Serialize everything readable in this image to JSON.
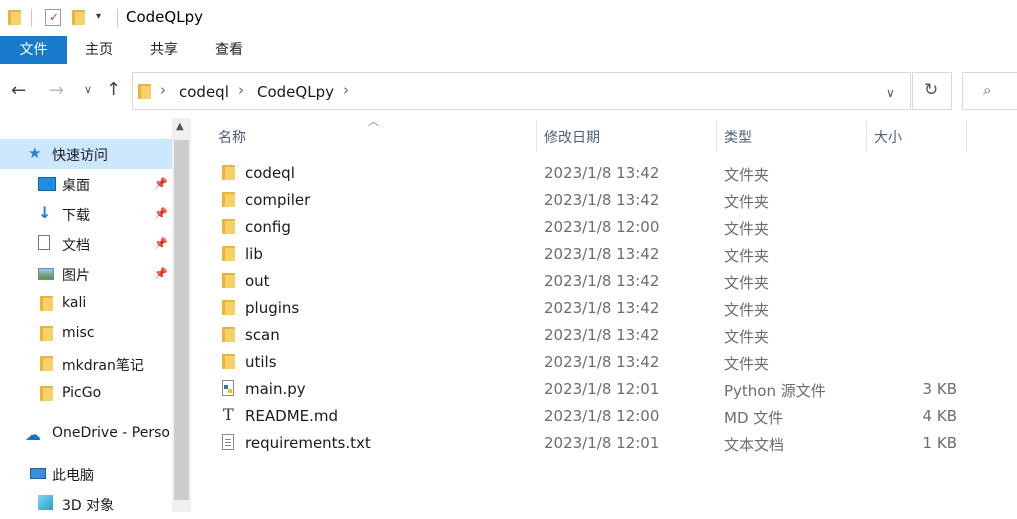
{
  "window": {
    "title": "CodeQLpy"
  },
  "ribbon": {
    "tabs": [
      "文件",
      "主页",
      "共享",
      "查看"
    ]
  },
  "address": {
    "crumbs": [
      "codeql",
      "CodeQLpy"
    ]
  },
  "nav": {
    "items": [
      {
        "label": "快速访问",
        "icon": "star-icon",
        "pinned": false
      },
      {
        "label": "桌面",
        "icon": "desktop-icon",
        "pinned": true
      },
      {
        "label": "下载",
        "icon": "download-icon",
        "pinned": true
      },
      {
        "label": "文档",
        "icon": "document-icon",
        "pinned": true
      },
      {
        "label": "图片",
        "icon": "pictures-icon",
        "pinned": true
      },
      {
        "label": "kali",
        "icon": "folder-icon",
        "pinned": false
      },
      {
        "label": "misc",
        "icon": "folder-icon",
        "pinned": false
      },
      {
        "label": "mkdran笔记",
        "icon": "folder-icon",
        "pinned": false
      },
      {
        "label": "PicGo",
        "icon": "folder-icon",
        "pinned": false
      },
      {
        "label": "OneDrive - Perso",
        "icon": "cloud-icon",
        "pinned": false
      },
      {
        "label": "此电脑",
        "icon": "computer-icon",
        "pinned": false
      },
      {
        "label": "3D 对象",
        "icon": "3d-objects-icon",
        "pinned": false
      }
    ]
  },
  "list": {
    "columns": {
      "name": "名称",
      "date": "修改日期",
      "type": "类型",
      "size": "大小"
    },
    "rows": [
      {
        "name": "codeql",
        "date": "2023/1/8 13:42",
        "type": "文件夹",
        "size": "",
        "icon": "folder-icon"
      },
      {
        "name": "compiler",
        "date": "2023/1/8 13:42",
        "type": "文件夹",
        "size": "",
        "icon": "folder-icon"
      },
      {
        "name": "config",
        "date": "2023/1/8 12:00",
        "type": "文件夹",
        "size": "",
        "icon": "folder-icon"
      },
      {
        "name": "lib",
        "date": "2023/1/8 13:42",
        "type": "文件夹",
        "size": "",
        "icon": "folder-icon"
      },
      {
        "name": "out",
        "date": "2023/1/8 13:42",
        "type": "文件夹",
        "size": "",
        "icon": "folder-icon"
      },
      {
        "name": "plugins",
        "date": "2023/1/8 13:42",
        "type": "文件夹",
        "size": "",
        "icon": "folder-icon"
      },
      {
        "name": "scan",
        "date": "2023/1/8 13:42",
        "type": "文件夹",
        "size": "",
        "icon": "folder-icon"
      },
      {
        "name": "utils",
        "date": "2023/1/8 13:42",
        "type": "文件夹",
        "size": "",
        "icon": "folder-icon"
      },
      {
        "name": "main.py",
        "date": "2023/1/8 12:01",
        "type": "Python 源文件",
        "size": "3 KB",
        "icon": "python-file-icon"
      },
      {
        "name": "README.md",
        "date": "2023/1/8 12:00",
        "type": "MD 文件",
        "size": "4 KB",
        "icon": "text-file-icon"
      },
      {
        "name": "requirements.txt",
        "date": "2023/1/8 12:01",
        "type": "文本文档",
        "size": "1 KB",
        "icon": "text-document-icon"
      }
    ]
  },
  "colors": {
    "accent": "#1979ca",
    "selected_nav": "#cce8ff",
    "folder": "#f7d165"
  }
}
